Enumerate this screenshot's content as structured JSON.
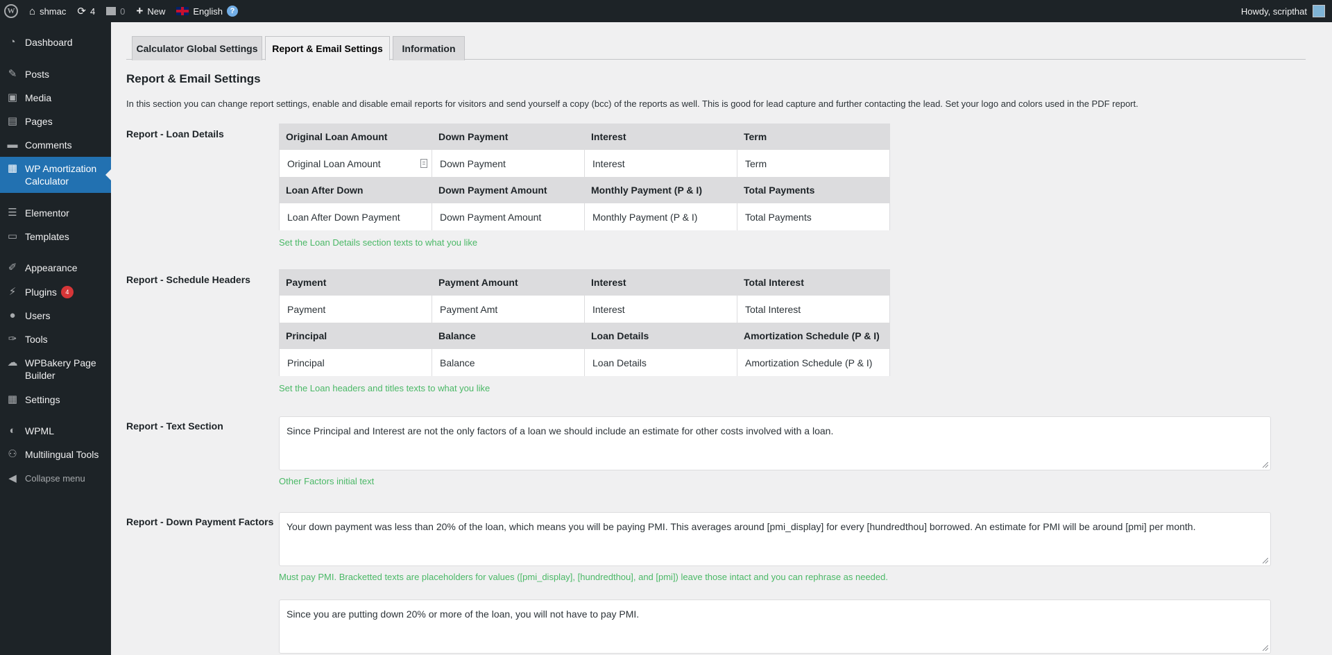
{
  "adminbar": {
    "site_name": "shmac",
    "updates_count": "4",
    "comments_count": "0",
    "new_label": "New",
    "language": "English",
    "howdy": "Howdy, scripthat"
  },
  "sidebar": {
    "items": [
      {
        "label": "Dashboard",
        "icon": "dashboard-icon"
      },
      {
        "label": "Posts",
        "icon": "pin-icon"
      },
      {
        "label": "Media",
        "icon": "media-icon"
      },
      {
        "label": "Pages",
        "icon": "pages-icon"
      },
      {
        "label": "Comments",
        "icon": "comments-icon"
      },
      {
        "label": "WP Amortization Calculator",
        "icon": "calculator-icon"
      },
      {
        "label": "Elementor",
        "icon": "elementor-icon"
      },
      {
        "label": "Templates",
        "icon": "folder-icon"
      },
      {
        "label": "Appearance",
        "icon": "brush-icon"
      },
      {
        "label": "Plugins",
        "icon": "plugin-icon",
        "badge": "4"
      },
      {
        "label": "Users",
        "icon": "users-icon"
      },
      {
        "label": "Tools",
        "icon": "wrench-icon"
      },
      {
        "label": "WPBakery Page Builder",
        "icon": "cloud-icon"
      },
      {
        "label": "Settings",
        "icon": "settings-icon"
      },
      {
        "label": "WPML",
        "icon": "wpml-icon"
      },
      {
        "label": "Multilingual Tools",
        "icon": "translate-icon"
      },
      {
        "label": "Collapse menu",
        "icon": "collapse-icon"
      }
    ]
  },
  "tabs": [
    {
      "label": "Calculator Global Settings"
    },
    {
      "label": "Report & Email Settings"
    },
    {
      "label": "Information"
    }
  ],
  "page": {
    "title": "Report & Email Settings",
    "intro": "In this section you can change report settings, enable and disable email reports for visitors and send yourself a copy (bcc) of the reports as well. This is good for lead capture and further contacting the lead. Set your logo and colors used in the PDF report."
  },
  "loan_details": {
    "label": "Report - Loan Details",
    "headers1": [
      "Original Loan Amount",
      "Down Payment",
      "Interest",
      "Term"
    ],
    "values1": [
      "Original Loan Amount",
      "Down Payment",
      "Interest",
      "Term"
    ],
    "headers2": [
      "Loan After Down",
      "Down Payment Amount",
      "Monthly Payment (P & I)",
      "Total Payments"
    ],
    "values2": [
      "Loan After Down Payment",
      "Down Payment Amount",
      "Monthly Payment (P & I)",
      "Total Payments"
    ],
    "hint": "Set the Loan Details section texts to what you like"
  },
  "schedule_headers": {
    "label": "Report - Schedule Headers",
    "headers1": [
      "Payment",
      "Payment Amount",
      "Interest",
      "Total Interest"
    ],
    "values1": [
      "Payment",
      "Payment Amt",
      "Interest",
      "Total Interest"
    ],
    "headers2": [
      "Principal",
      "Balance",
      "Loan Details",
      "Amortization Schedule (P & I)"
    ],
    "values2": [
      "Principal",
      "Balance",
      "Loan Details",
      "Amortization Schedule (P & I)"
    ],
    "hint": "Set the Loan headers and titles texts to what you like"
  },
  "text_section": {
    "label": "Report - Text Section",
    "value": "Since Principal and Interest are not the only factors of a loan we should include an estimate for other costs involved with a loan.",
    "hint": "Other Factors initial text"
  },
  "down_payment": {
    "label": "Report - Down Payment Factors",
    "value1": "Your down payment was less than 20% of the loan, which means you will be paying PMI. This averages around [pmi_display] for every [hundredthou] borrowed. An estimate for PMI will be around [pmi] per month.",
    "hint": "Must pay PMI. Bracketted texts are placeholders for values ([pmi_display], [hundredthou], and [pmi]) leave those intact and you can rephrase as needed.",
    "value2": "Since you are putting down 20% or more of the loan, you will not have to pay PMI."
  }
}
